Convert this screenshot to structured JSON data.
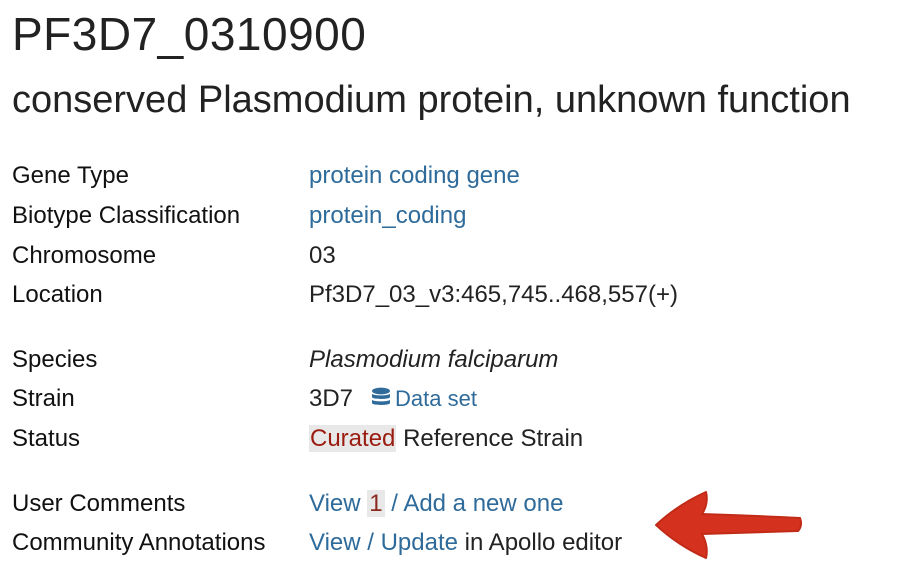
{
  "gene": {
    "id": "PF3D7_0310900",
    "description": "conserved Plasmodium protein, unknown function"
  },
  "fields": {
    "gene_type": {
      "label": "Gene Type",
      "value": "protein coding gene"
    },
    "biotype": {
      "label": "Biotype Classification",
      "value": "protein_coding"
    },
    "chromosome": {
      "label": "Chromosome",
      "value": "03"
    },
    "location": {
      "label": "Location",
      "value": "Pf3D7_03_v3:465,745..468,557(+)"
    },
    "species": {
      "label": "Species",
      "value": "Plasmodium falciparum"
    },
    "strain": {
      "label": "Strain",
      "value": "3D7",
      "dataset_label": "Data set"
    },
    "status": {
      "label": "Status",
      "badge": "Curated",
      "text": "Reference Strain"
    },
    "user_comments": {
      "label": "User Comments",
      "view_label": "View",
      "count": "1",
      "separator": "/",
      "add_label": "Add a new one"
    },
    "community_annotations": {
      "label": "Community Annotations",
      "view_update_label": "View / Update",
      "suffix": "in Apollo editor"
    }
  },
  "icons": {
    "dataset": "database-icon",
    "annotation": "arrow-left-icon"
  },
  "colors": {
    "link": "#2f6b9a",
    "curated": "#9a1c10",
    "arrow": "#d4321e"
  }
}
